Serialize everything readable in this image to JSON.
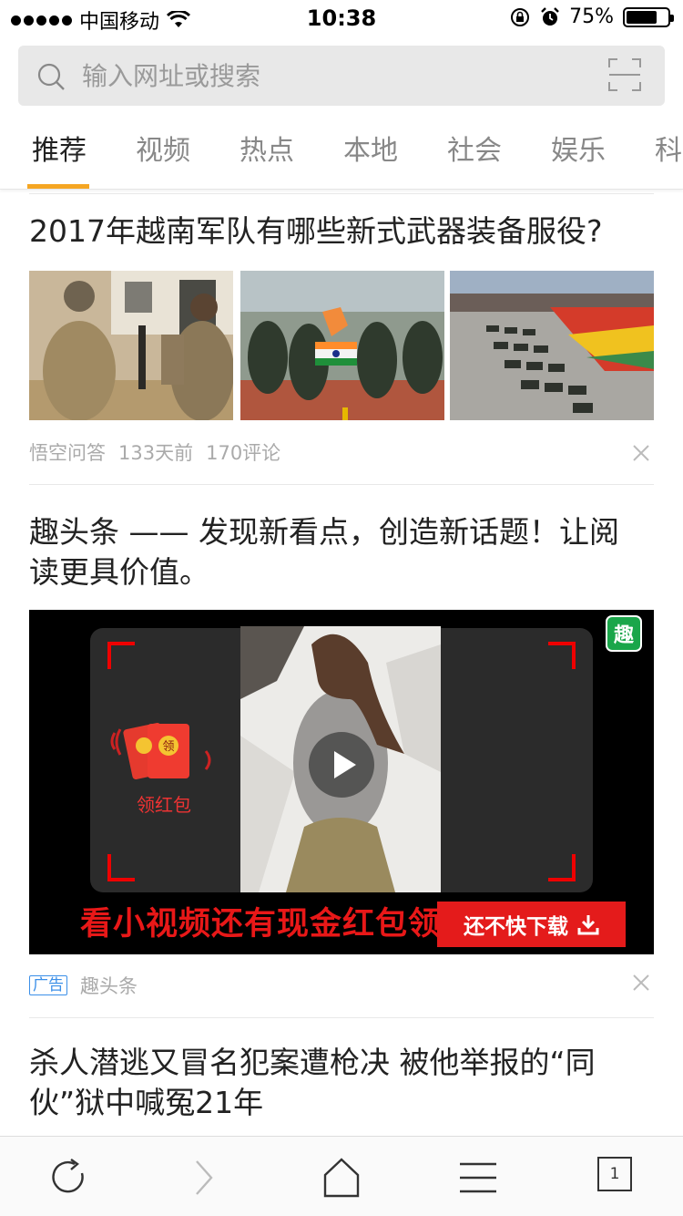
{
  "status_bar": {
    "carrier": "中国移动",
    "time": "10:38",
    "battery": "75%",
    "battery_level": 0.75
  },
  "search": {
    "placeholder": "输入网址或搜索"
  },
  "tabs": [
    {
      "label": "推荐",
      "active": true
    },
    {
      "label": "视频"
    },
    {
      "label": "热点"
    },
    {
      "label": "本地"
    },
    {
      "label": "社会"
    },
    {
      "label": "娱乐"
    },
    {
      "label": "科"
    }
  ],
  "feed": {
    "article1": {
      "title": "2017年越南军队有哪些新式武器装备服役?",
      "source": "悟空问答",
      "time": "133天前",
      "comments": "170评论"
    },
    "ad": {
      "title": "趣头条 —— 发现新看点，创造新话题！让阅读更具价值。",
      "title_line1": "趣头条 —— 发现新看点，创造新话题！让阅",
      "title_line2": "读更具价值。",
      "hongbao_label": "领红包",
      "hongbao_char": "领",
      "badge": "趣",
      "banner_text": "看小视频还有现金红包领哦!",
      "download_button": "还不快下载",
      "ad_tag": "广告",
      "source": "趣头条"
    },
    "article3": {
      "title_line1": "杀人潜逃又冒名犯案遭枪决 被他举报的“同",
      "title_line2": "伙”狱中喊冤21年"
    }
  },
  "bottom_bar": {
    "tab_count": "1"
  },
  "colors": {
    "accent": "#f5a623",
    "ad_red": "#e41b1b",
    "ad_tag_blue": "#3b8fe8"
  }
}
